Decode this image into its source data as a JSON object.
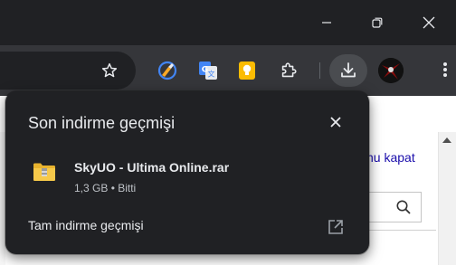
{
  "window_controls": {
    "minimize_icon": "minimize-icon",
    "restore_icon": "restore-icon",
    "close_icon": "close-icon"
  },
  "toolbar": {
    "bookmark_icon": "star-icon",
    "extensions": [
      {
        "name": "brush-extension-icon",
        "color": "#f9a825"
      },
      {
        "name": "google-translate-icon",
        "color": "#4285f4"
      },
      {
        "name": "keep-lightbulb-icon",
        "color": "#fbbc04"
      },
      {
        "name": "puzzle-extensions-icon",
        "color": "#e8eaed"
      }
    ],
    "download_icon": "download-icon",
    "avatar": "profile-avatar",
    "menu_icon": "kebab-menu-icon"
  },
  "page": {
    "link_text": "nu kapat",
    "search_icon": "search-icon"
  },
  "downloads_bubble": {
    "title": "Son indirme geçmişi",
    "items": [
      {
        "file_name": "SkyUO - Ultima Online.rar",
        "meta": "1,3 GB • Bitti",
        "icon": "zip-folder-icon"
      }
    ],
    "full_history_label": "Tam indirme geçmişi",
    "open_icon": "open-in-new-icon"
  },
  "colors": {
    "titlebar_bg": "#202124",
    "toolbar_bg": "#35363a",
    "bubble_bg": "#202124",
    "text_primary": "#e8eaed",
    "text_secondary": "#bdc1c6",
    "link": "#1a0dab"
  }
}
